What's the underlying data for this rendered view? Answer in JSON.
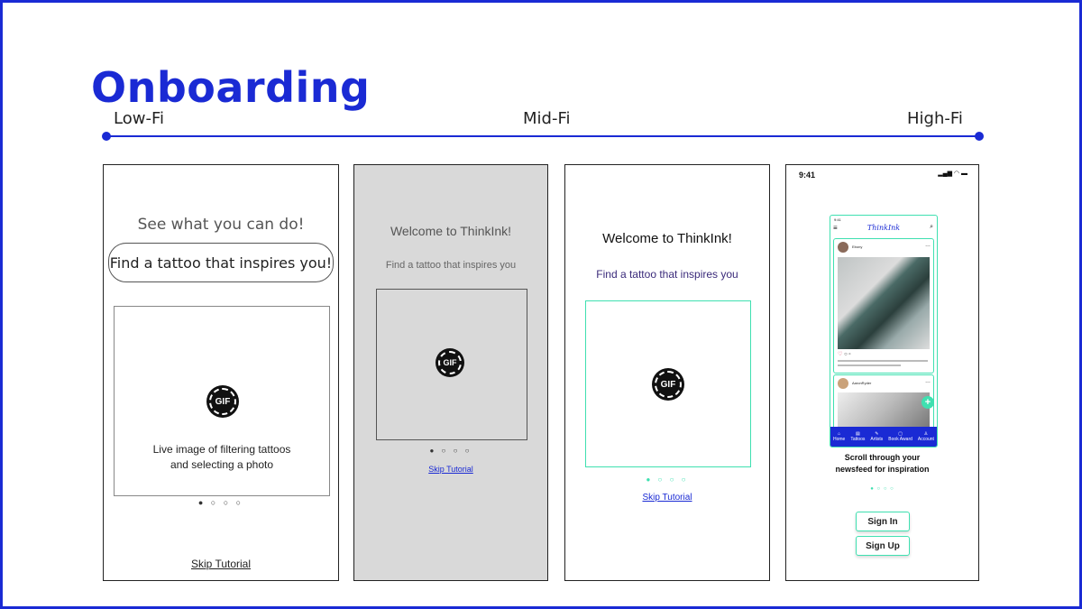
{
  "title": "Onboarding",
  "timeline": {
    "low": "Low-Fi",
    "mid": "Mid-Fi",
    "high": "High-Fi"
  },
  "colors": {
    "brand": "#1a2ad4",
    "accent": "#3fe0b0",
    "midfi_bg": "#d9d9d9"
  },
  "panel_lowfi": {
    "heading": "See what you can do!",
    "pill": "Find a tattoo that inspires you!",
    "gif": "GIF",
    "caption_line1": "Live image of filtering tattoos",
    "caption_line2": "and selecting a photo",
    "pagination": "● ○ ○ ○",
    "skip": "Skip Tutorial"
  },
  "panel_midfi_grey": {
    "heading": "Welcome to ThinkInk!",
    "subheading": "Find a tattoo that inspires you",
    "gif": "GIF",
    "pagination": "● ○ ○ ○",
    "skip": "Skip Tutorial"
  },
  "panel_midfi_white": {
    "heading": "Welcome to ThinkInk!",
    "subheading": "Find a tattoo that inspires you",
    "gif": "GIF",
    "pagination": "● ○ ○ ○",
    "skip": "Skip Tutorial"
  },
  "panel_highfi": {
    "status_time": "9:41",
    "status_icons": "▂▄▆ ◠ ▬",
    "inner_time": "9:41",
    "logo": "ThinkInk",
    "post1_user": "Ebony",
    "post2_user": "AaronRyder",
    "nav_items": [
      "Home",
      "Tattoos",
      "Artists",
      "Book Award",
      "Account"
    ],
    "caption_line1": "Scroll through your",
    "caption_line2": "newsfeed for inspiration",
    "pagination": "● ○ ○ ○",
    "sign_in": "Sign In",
    "sign_up": "Sign Up"
  }
}
